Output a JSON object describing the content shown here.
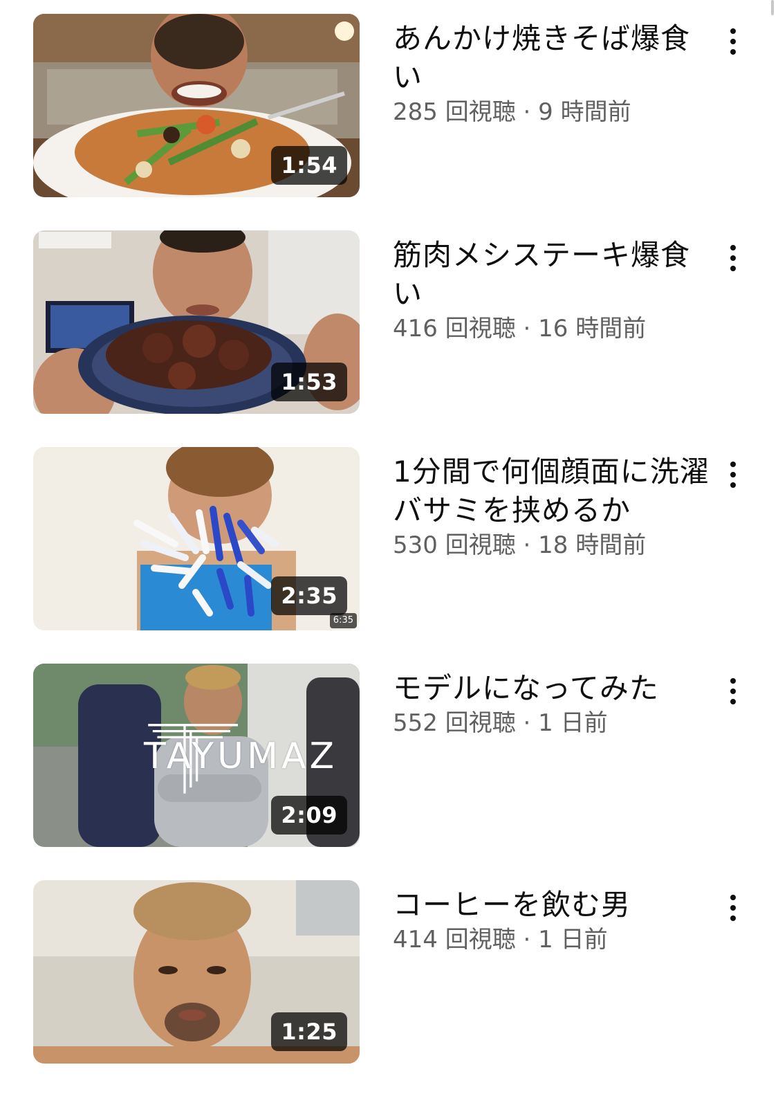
{
  "videos": [
    {
      "title": "あんかけ焼きそば爆食い",
      "meta": "285 回視聴 · 9 時間前",
      "duration": "1:54",
      "thumbnail_icon": "food-video-thumbnail"
    },
    {
      "title": "筋肉メシステーキ爆食い",
      "meta": "416 回視聴 · 16 時間前",
      "duration": "1:53",
      "thumbnail_icon": "steak-video-thumbnail"
    },
    {
      "title": "1分間で何個顔面に洗濯バサミを挟めるか",
      "meta": "530 回視聴 · 18 時間前",
      "duration": "2:35",
      "sub_duration": "6:35",
      "thumbnail_icon": "clothespin-video-thumbnail"
    },
    {
      "title": "モデルになってみた",
      "meta": "552 回視聴 · 1 日前",
      "duration": "2:09",
      "overlay_text": "TAYUMAZ",
      "thumbnail_icon": "gym-video-thumbnail"
    },
    {
      "title": "コーヒーを飲む男",
      "meta": "414 回視聴 · 1 日前",
      "duration": "1:25",
      "thumbnail_icon": "portrait-video-thumbnail"
    }
  ],
  "colors": {
    "title": "#0f0f0f",
    "meta": "#606060",
    "badge_bg": "#000000",
    "background": "#ffffff"
  },
  "icons": {
    "more": "more-vert-icon"
  }
}
